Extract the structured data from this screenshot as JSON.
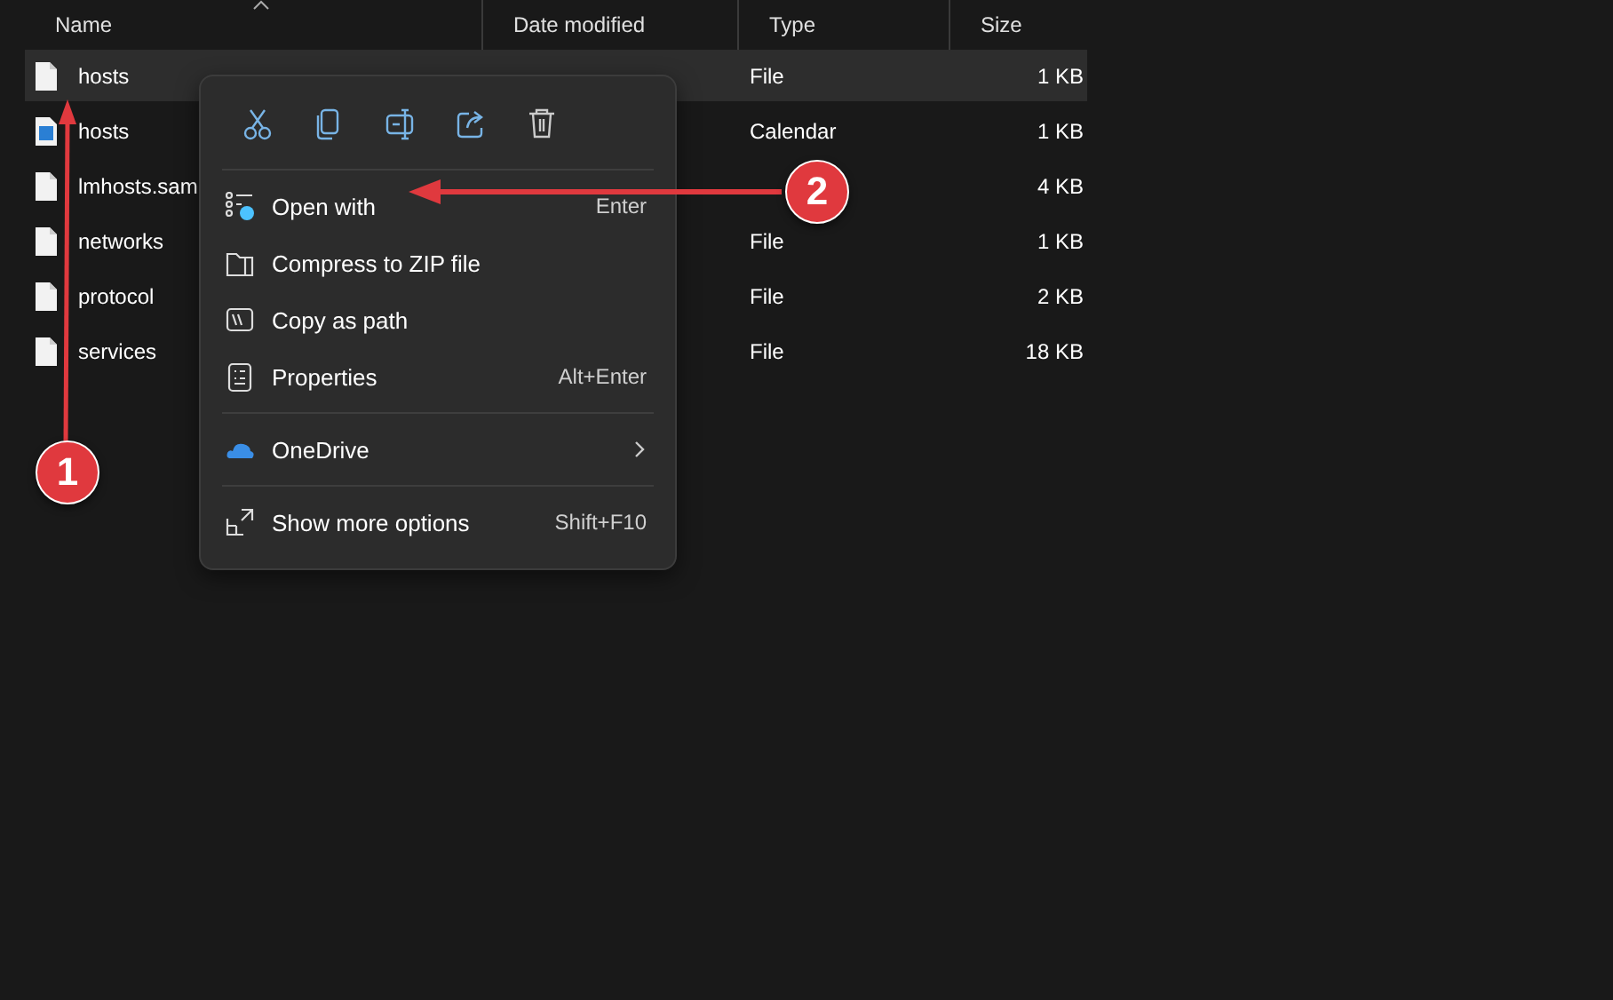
{
  "columns": [
    {
      "label": "Name"
    },
    {
      "label": "Date modified"
    },
    {
      "label": "Type"
    },
    {
      "label": "Size"
    }
  ],
  "rows": [
    {
      "name": "hosts",
      "kind": "file",
      "type": "File",
      "size": "1 KB",
      "selected": true
    },
    {
      "name": "hosts",
      "kind": "calendar",
      "type": "Calendar",
      "size": "1 KB",
      "selected": false
    },
    {
      "name": "lmhosts.sam",
      "kind": "file",
      "size": "4 KB",
      "selected": false
    },
    {
      "name": "networks",
      "kind": "file",
      "type": "File",
      "size": "1 KB",
      "selected": false
    },
    {
      "name": "protocol",
      "kind": "file",
      "type": "File",
      "size": "2 KB",
      "selected": false
    },
    {
      "name": "services",
      "kind": "file",
      "type": "File",
      "size": "18 KB",
      "selected": false
    }
  ],
  "context_menu": {
    "groups": [
      [
        {
          "label": "Open with",
          "shortcut": "Enter",
          "has_submenu": false
        },
        {
          "label": "Compress to ZIP file",
          "has_submenu": false
        },
        {
          "label": "Copy as path",
          "has_submenu": false
        },
        {
          "label": "Properties",
          "shortcut": "Alt+Enter",
          "has_submenu": false
        }
      ],
      [
        {
          "label": "OneDrive",
          "has_submenu": true
        }
      ],
      [
        {
          "label": "Show more options",
          "shortcut": "Shift+F10",
          "has_submenu": false
        }
      ]
    ]
  },
  "annotations": [
    {
      "label": "1"
    },
    {
      "label": "2"
    }
  ]
}
